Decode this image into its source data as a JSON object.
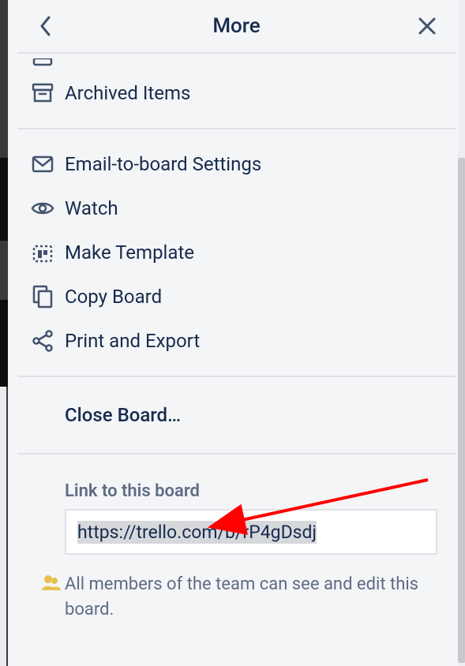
{
  "header": {
    "title": "More"
  },
  "menu": {
    "section1": [
      {
        "label": "Archived Items",
        "icon": "archive-icon"
      }
    ],
    "section2": [
      {
        "label": "Email-to-board Settings",
        "icon": "mail-icon"
      },
      {
        "label": "Watch",
        "icon": "eye-icon"
      },
      {
        "label": "Make Template",
        "icon": "template-icon"
      },
      {
        "label": "Copy Board",
        "icon": "copy-icon"
      },
      {
        "label": "Print and Export",
        "icon": "share-icon"
      }
    ],
    "close_board_label": "Close Board…"
  },
  "link": {
    "section_label": "Link to this board",
    "url": "https://trello.com/b/rP4gDsdj",
    "permission_text": "All members of the team can see and edit this board.",
    "permission_icon": "team-icon"
  },
  "colors": {
    "arrow": "#ff0000"
  }
}
